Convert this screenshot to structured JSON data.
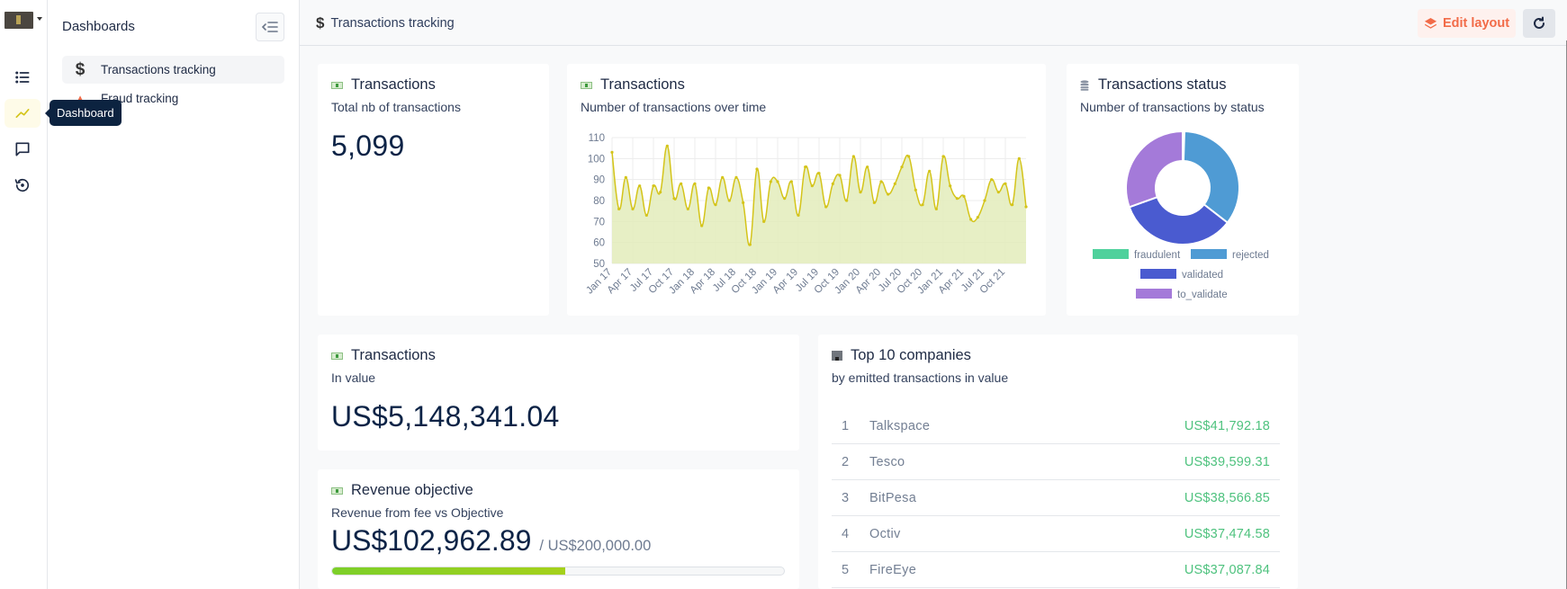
{
  "rail": {
    "items": [
      {
        "name": "list-icon"
      },
      {
        "name": "chart-line-icon",
        "active": true
      },
      {
        "name": "chat-icon"
      },
      {
        "name": "history-icon"
      }
    ],
    "tooltip": "Dashboard"
  },
  "sidebar": {
    "title": "Dashboards",
    "items": [
      {
        "label": "Transactions tracking",
        "icon": "dollar-icon",
        "active": true
      },
      {
        "label": "Fraud tracking",
        "icon": "warning-icon"
      }
    ]
  },
  "header": {
    "title": "Transactions tracking",
    "edit_layout": "Edit layout"
  },
  "colors": {
    "accent": "#f26b48",
    "line": "#d4c41a",
    "area": "#e3ecbb",
    "value_green": "#4ec27e",
    "fraudulent": "#4fd19c",
    "rejected": "#4f9bd4",
    "validated": "#4a5bd0",
    "to_validate": "#a47ad9"
  },
  "cards": {
    "total": {
      "title": "Transactions",
      "subtitle": "Total nb of transactions",
      "value": "5,099"
    },
    "overtime": {
      "title": "Transactions",
      "subtitle": "Number of transactions over time"
    },
    "status": {
      "title": "Transactions status",
      "subtitle": "Number of transactions by status"
    },
    "in_value": {
      "title": "Transactions",
      "subtitle": "In value",
      "value": "US$5,148,341.04"
    },
    "revenue": {
      "title": "Revenue objective",
      "subtitle": "Revenue from fee vs Objective",
      "value": "US$102,962.89",
      "objective": "/ US$200,000.00",
      "progress_pct": 51.5
    },
    "top10": {
      "title": "Top 10 companies",
      "subtitle": "by emitted transactions in value",
      "rows": [
        {
          "rank": "1",
          "name": "Talkspace",
          "value": "US$41,792.18"
        },
        {
          "rank": "2",
          "name": "Tesco",
          "value": "US$39,599.31"
        },
        {
          "rank": "3",
          "name": "BitPesa",
          "value": "US$38,566.85"
        },
        {
          "rank": "4",
          "name": "Octiv",
          "value": "US$37,474.58"
        },
        {
          "rank": "5",
          "name": "FireEye",
          "value": "US$37,087.84"
        }
      ]
    }
  },
  "chart_data": [
    {
      "type": "area",
      "title": "Number of transactions over time",
      "xlabel": "",
      "ylabel": "",
      "ylim": [
        50,
        110
      ],
      "yticks": [
        50,
        60,
        70,
        80,
        90,
        100,
        110
      ],
      "xtick_labels": [
        "Jan 17",
        "Apr 17",
        "Jul 17",
        "Oct 17",
        "Jan 18",
        "Apr 18",
        "Jul 18",
        "Oct 18",
        "Jan 19",
        "Apr 19",
        "Jul 19",
        "Oct 19",
        "Jan 20",
        "Apr 20",
        "Jul 20",
        "Oct 20",
        "Jan 21",
        "Apr 21",
        "Jul 21",
        "Oct 21"
      ],
      "grid": true,
      "x": "monthly Jan 2017 – Dec 2021",
      "values": [
        103,
        76,
        91,
        76,
        87,
        73,
        87,
        84,
        106,
        81,
        88,
        76,
        88,
        68,
        86,
        78,
        91,
        80,
        91,
        79,
        59,
        95,
        70,
        89,
        89,
        81,
        89,
        73,
        96,
        87,
        93,
        77,
        88,
        92,
        80,
        101,
        84,
        96,
        79,
        89,
        83,
        88,
        96,
        101,
        85,
        78,
        94,
        76,
        101,
        87,
        81,
        82,
        71,
        72,
        80,
        90,
        84,
        88,
        78,
        100,
        77
      ]
    },
    {
      "type": "pie",
      "title": "Number of transactions by status",
      "donut": true,
      "legend": "bottom",
      "labels": [
        "fraudulent",
        "rejected",
        "validated",
        "to_validate"
      ],
      "values": [
        0.5,
        35,
        34,
        30.5
      ]
    }
  ]
}
